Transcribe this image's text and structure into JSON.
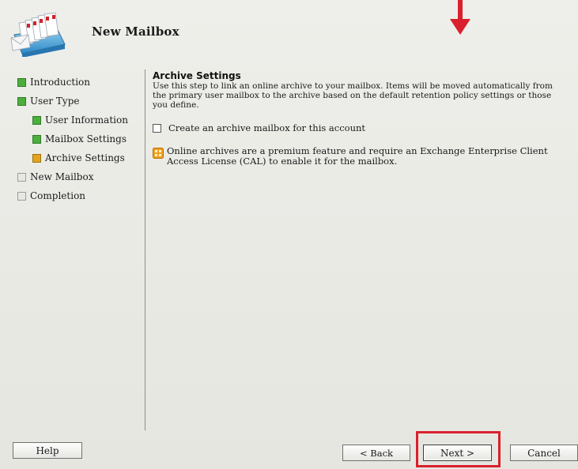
{
  "header": {
    "title": "New Mailbox"
  },
  "nav": {
    "items": [
      {
        "label": "Introduction",
        "status": "complete",
        "sub": false
      },
      {
        "label": "User Type",
        "status": "complete",
        "sub": false
      },
      {
        "label": "User Information",
        "status": "complete",
        "sub": true
      },
      {
        "label": "Mailbox Settings",
        "status": "complete",
        "sub": true
      },
      {
        "label": "Archive Settings",
        "status": "current",
        "sub": true
      },
      {
        "label": "New Mailbox",
        "status": "pending",
        "sub": false
      },
      {
        "label": "Completion",
        "status": "pending",
        "sub": false
      }
    ]
  },
  "main": {
    "section_title": "Archive Settings",
    "description": "Use this step to link an online archive to your mailbox. Items will be moved automatically from the primary user mailbox to the archive based on the default retention policy settings or those you define.",
    "checkbox_label": "Create an archive mailbox for this account",
    "checkbox_checked": false,
    "info_text": "Online archives are a premium feature and require an Exchange Enterprise Client Access License (CAL) to enable it for the mailbox."
  },
  "buttons": {
    "help": "Help",
    "back": "< Back",
    "next": "Next >",
    "cancel": "Cancel"
  },
  "colors": {
    "complete": "#4cae3c",
    "current": "#e2a41b",
    "pending": "#e7e7e3",
    "highlight": "#d9202c"
  },
  "icons": {
    "header": "mailbox-wizard-icon",
    "info": "info-icon",
    "annotation": "red-arrow-icon"
  }
}
